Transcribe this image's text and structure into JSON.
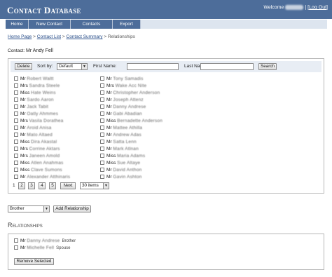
{
  "header": {
    "title": "Contact Database",
    "welcome_label": "Welcome",
    "separator": "|",
    "logout_label": "Log Out"
  },
  "nav": {
    "items": [
      {
        "label": "Home"
      },
      {
        "label": "New Contact"
      },
      {
        "label": "Contacts"
      },
      {
        "label": "Export"
      }
    ]
  },
  "breadcrumb": {
    "home": "Home Page",
    "contact_list": "Contact List",
    "contact_summary": "Contact Summary",
    "current": "Relationships",
    "sep": ">"
  },
  "contact": {
    "label": "Contact:",
    "name": "Mr  Andy  Fell"
  },
  "toolbar": {
    "delete_label": "Delete",
    "sort_label": "Sort by:",
    "sort_value": "Default",
    "first_name_label": "First Name:",
    "first_name_value": "",
    "last_name_label": "Last Name:",
    "last_name_value": "",
    "search_label": "Search"
  },
  "contacts": {
    "left": [
      {
        "title": "Mr",
        "name": "Robert Waltt"
      },
      {
        "title": "Mrs",
        "name": "Sandra Steele"
      },
      {
        "title": "Miss",
        "name": "Hate Weins"
      },
      {
        "title": "Mr",
        "name": "Sardo Aaron"
      },
      {
        "title": "Mr",
        "name": "Jack Tabit"
      },
      {
        "title": "Mr",
        "name": "Oatly Ahmmes"
      },
      {
        "title": "Mrs",
        "name": "Vasila Dorathea"
      },
      {
        "title": "Mr",
        "name": "Aroid Anisa"
      },
      {
        "title": "Mr",
        "name": "Mato Altaed"
      },
      {
        "title": "Miss",
        "name": "Dira Akastal"
      },
      {
        "title": "Mrs",
        "name": "Corrine Aktars"
      },
      {
        "title": "Mrs",
        "name": "Janeen Amold"
      },
      {
        "title": "Miss",
        "name": "Atlen Anahmas"
      },
      {
        "title": "Miss",
        "name": "Clave Sumons"
      },
      {
        "title": "Mr",
        "name": "Alexander Atthinaris"
      }
    ],
    "right": [
      {
        "title": "Mr",
        "name": "Tony Samadis"
      },
      {
        "title": "Mrs",
        "name": "Wake Acc Nite"
      },
      {
        "title": "Mr",
        "name": "Christopher Anderson"
      },
      {
        "title": "Mr",
        "name": "Joseph Attenz"
      },
      {
        "title": "Mr",
        "name": "Danny Andrese"
      },
      {
        "title": "Mr",
        "name": "Gabi Abadian"
      },
      {
        "title": "Miss",
        "name": "Bernadette Anderson"
      },
      {
        "title": "Mr",
        "name": "Mattee Athilla"
      },
      {
        "title": "Mr",
        "name": "Andrew Adas"
      },
      {
        "title": "Mr",
        "name": "Satta Lenn"
      },
      {
        "title": "Mr",
        "name": "Mark Atlnan"
      },
      {
        "title": "Miss",
        "name": "Maria Adams"
      },
      {
        "title": "Miss",
        "name": "Sue Altaye"
      },
      {
        "title": "Mr",
        "name": "David Anthon"
      },
      {
        "title": "Mr",
        "name": "Gavin Ashton"
      }
    ]
  },
  "pager": {
    "current": "1",
    "pages": [
      "2",
      "3",
      "4",
      "5"
    ],
    "next_label": "Next",
    "per_page": "30 items"
  },
  "add_relationship": {
    "type_value": "Brother",
    "button_label": "Add Relationship"
  },
  "relationships": {
    "heading": "Relationships",
    "items": [
      {
        "title": "Mr",
        "name": "Danny Andrese",
        "type": "Brother"
      },
      {
        "title": "Mr",
        "name": "Michelle Fell",
        "type": "Spouse"
      }
    ],
    "remove_label": "Remove Selected"
  },
  "colors": {
    "header_bg": "#4d6d9a",
    "nav_bg": "#4d6d9a",
    "link": "#2a4f8a"
  }
}
